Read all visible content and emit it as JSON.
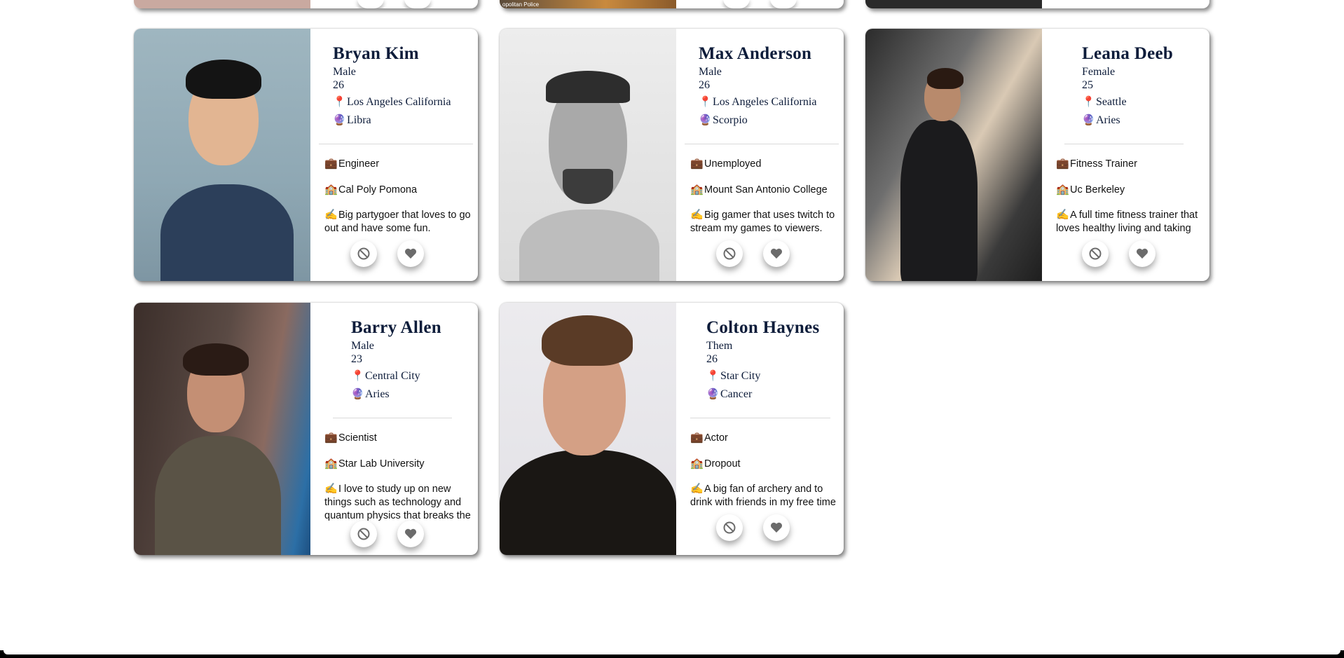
{
  "partial_row": {
    "police_caption": "opolitan Police"
  },
  "profiles": [
    {
      "name": "Bryan Kim",
      "gender": "Male",
      "age": "26",
      "location": "Los Angeles California",
      "sign": "Libra",
      "job": "Engineer",
      "school": "Cal Poly Pomona",
      "bio": "Big partygoer that loves to go out and have some fun."
    },
    {
      "name": "Max Anderson",
      "gender": "Male",
      "age": "26",
      "location": "Los Angeles California",
      "sign": "Scorpio",
      "job": "Unemployed",
      "school": "Mount San Antonio College",
      "bio": "Big gamer that uses twitch to stream my games to viewers."
    },
    {
      "name": "Leana Deeb",
      "gender": "Female",
      "age": "25",
      "location": "Seattle",
      "sign": "Aries",
      "job": "Fitness Trainer",
      "school": "Uc Berkeley",
      "bio": "A full time fitness trainer that loves healthy living and taking risks."
    },
    {
      "name": "Barry Allen",
      "gender": "Male",
      "age": "23",
      "location": "Central City",
      "sign": "Aries",
      "job": "Scientist",
      "school": "Star Lab University",
      "bio": "I love to study up on new things such as technology and quantum physics that breaks the time barrier."
    },
    {
      "name": "Colton Haynes",
      "gender": "Them",
      "age": "26",
      "location": "Star City",
      "sign": "Cancer",
      "job": "Actor",
      "school": "Dropout",
      "bio": "A big fan of archery and to drink with friends in my free time as well."
    }
  ],
  "icons": {
    "location": "📍",
    "zodiac": "🔮",
    "job": "💼",
    "school": "🏫",
    "bio": "✍️"
  },
  "colors": {
    "name_text": "#0d1c3a",
    "button_icon": "#6b6b6b"
  }
}
